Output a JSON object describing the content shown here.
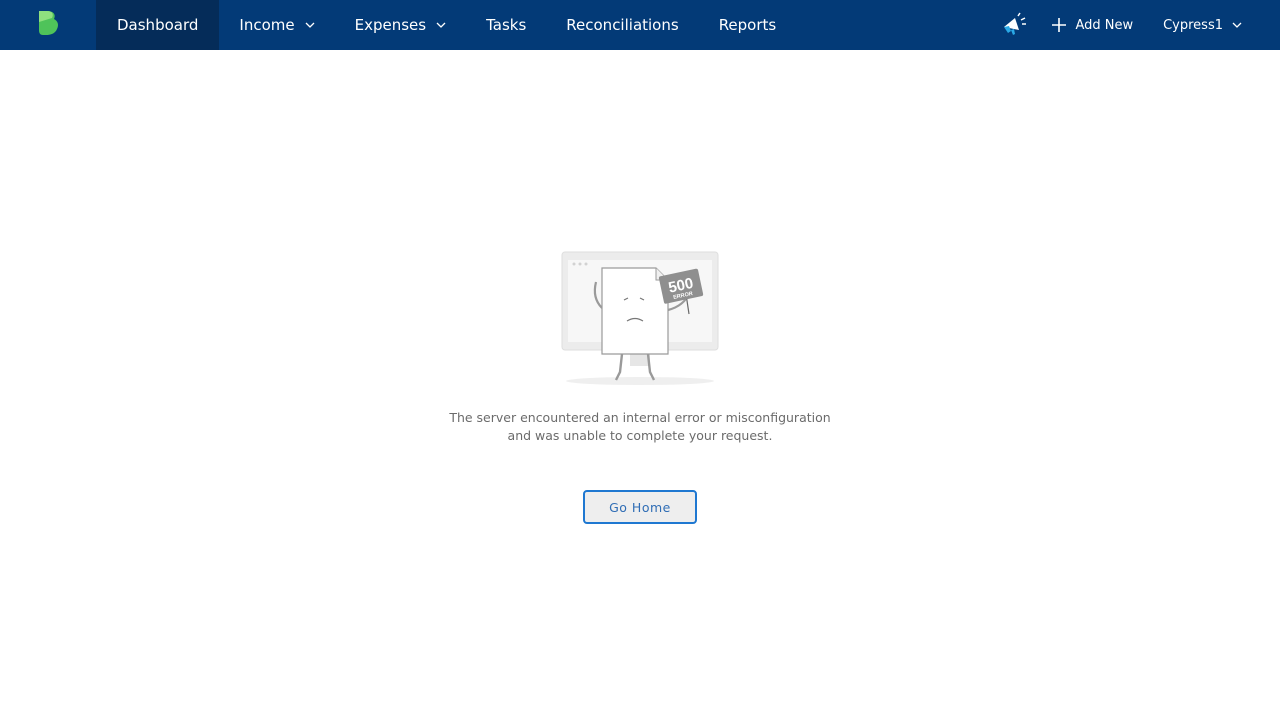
{
  "header": {
    "logo_icon": "brand-b-logo-icon",
    "nav": [
      {
        "label": "Dashboard",
        "active": true,
        "dropdown": false
      },
      {
        "label": "Income",
        "active": false,
        "dropdown": true
      },
      {
        "label": "Expenses",
        "active": false,
        "dropdown": true
      },
      {
        "label": "Tasks",
        "active": false,
        "dropdown": false
      },
      {
        "label": "Reconciliations",
        "active": false,
        "dropdown": false
      },
      {
        "label": "Reports",
        "active": false,
        "dropdown": false
      }
    ],
    "announcements_icon": "megaphone-icon",
    "add_new_label": "Add New",
    "user_label": "Cypress1"
  },
  "error": {
    "badge_code": "500",
    "badge_word": "ERROR",
    "message_line1": "The server encountered an internal error or misconfiguration",
    "message_line2": "and was unable to complete your request.",
    "button_label": "Go Home"
  },
  "colors": {
    "header_bg": "#033a77",
    "active_tab_bg": "#052c59",
    "logo_green": "#5fcf6a",
    "button_border": "#1f78d1",
    "button_text": "#2f6db5"
  }
}
